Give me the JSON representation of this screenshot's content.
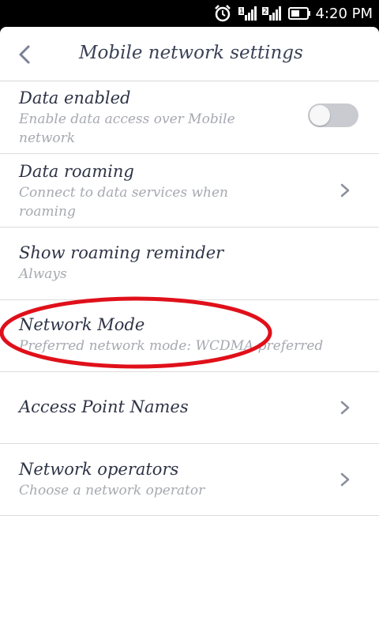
{
  "status_bar": {
    "time": "4:20 PM",
    "icons": [
      "alarm-icon",
      "signal-sim1-icon",
      "signal-sim2-icon",
      "battery-icon"
    ],
    "sim1_label": "1",
    "sim2_label": "2"
  },
  "header": {
    "title": "Mobile network settings",
    "back_icon": "chevron-left-icon"
  },
  "settings": {
    "data_enabled": {
      "title": "Data enabled",
      "subtitle": "Enable data access over Mobile network",
      "toggle_on": false
    },
    "data_roaming": {
      "title": "Data roaming",
      "subtitle": "Connect to data services when roaming"
    },
    "roaming_reminder": {
      "title": "Show roaming reminder",
      "subtitle": "Always"
    },
    "network_mode": {
      "title": "Network Mode",
      "subtitle": "Preferred network mode: WCDMA preferred"
    },
    "apn": {
      "title": "Access Point Names"
    },
    "network_operators": {
      "title": "Network operators",
      "subtitle": "Choose a network operator"
    }
  },
  "colors": {
    "title_text": "#3a4256",
    "subtitle_text": "#a6a9b0",
    "annotation_red": "#e0101a"
  }
}
